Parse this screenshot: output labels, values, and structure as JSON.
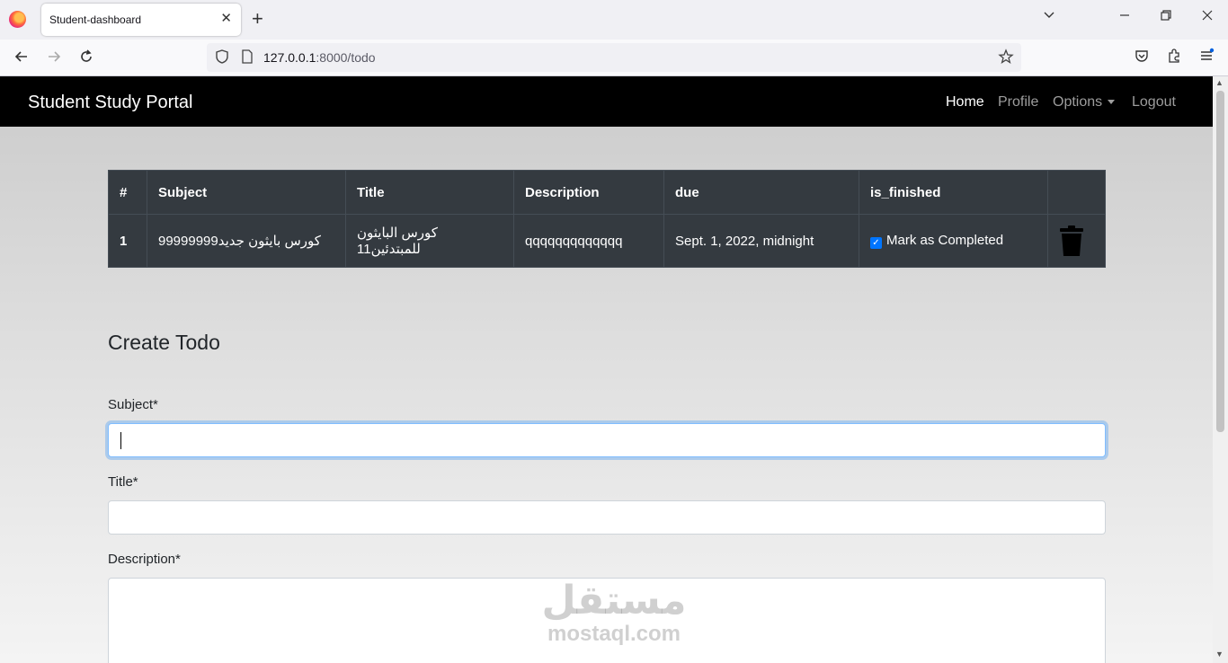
{
  "browser": {
    "tab_title": "Student-dashboard",
    "tab_close": "✕",
    "new_tab": "+",
    "url_host": "127.0.0.1",
    "url_path": ":8000/todo",
    "icons": [
      "firefox-logo",
      "back-icon",
      "forward-icon",
      "reload-icon",
      "shield-icon",
      "page-icon",
      "star-icon",
      "pocket-icon",
      "extensions-icon",
      "menu-icon"
    ]
  },
  "site": {
    "brand": "Student Study Portal",
    "nav": {
      "home": "Home",
      "profile": "Profile",
      "options": "Options",
      "logout": "Logout"
    }
  },
  "table": {
    "headers": [
      "#",
      "Subject",
      "Title",
      "Description",
      "due",
      "is_finished",
      ""
    ],
    "rows": [
      {
        "num": "1",
        "subject": "كورس بايثون جديد99999999",
        "title": "كورس البايثون للمبتدئين11",
        "description": "qqqqqqqqqqqqq",
        "due": "Sept. 1, 2022, midnight",
        "finished_label": "Mark as Completed",
        "finished": true
      }
    ]
  },
  "form": {
    "title": "Create Todo",
    "subject_label": "Subject*",
    "title_label": "Title*",
    "description_label": "Description*",
    "subject_value": "",
    "title_value": "",
    "description_value": ""
  },
  "watermark": {
    "arabic": "مستقل",
    "latin": "mostaql.com"
  },
  "colors": {
    "navbar": "#000000",
    "table_bg": "#343a40",
    "checkbox": "#0075ff",
    "focus_border": "#80bdff"
  }
}
